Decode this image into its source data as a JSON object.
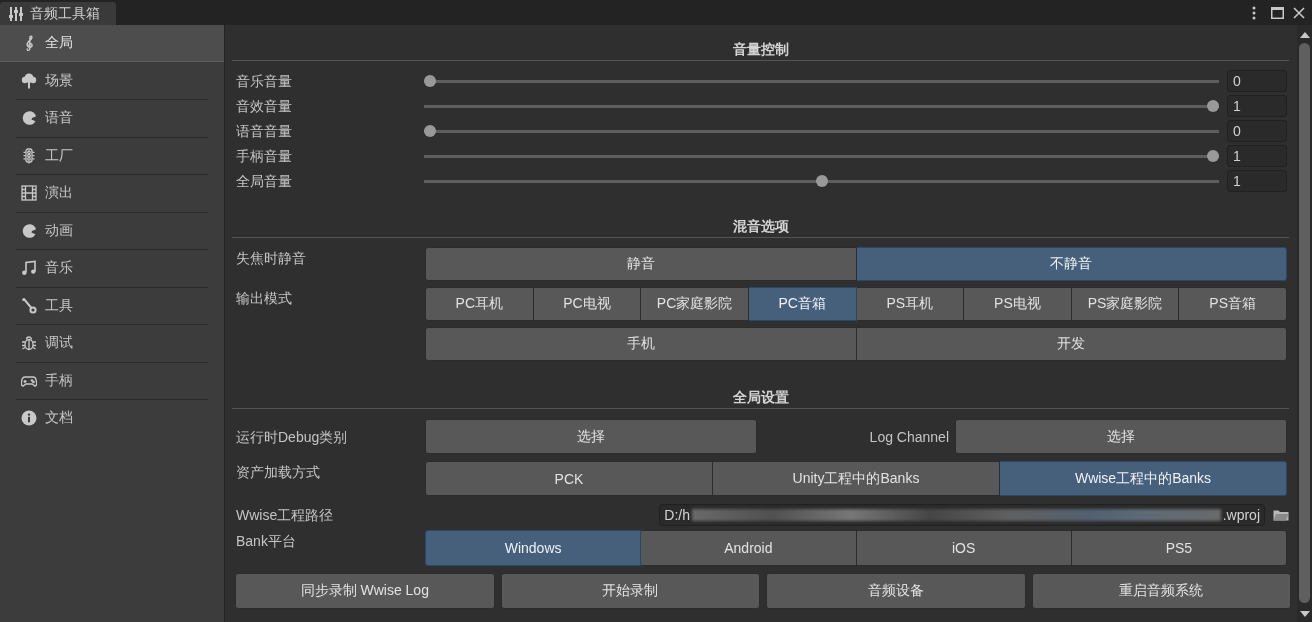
{
  "window": {
    "tab_title": "音频工具箱"
  },
  "sidebar": {
    "items": [
      {
        "label": "全局",
        "selected": true
      },
      {
        "label": "场景",
        "selected": false
      },
      {
        "label": "语音",
        "selected": false
      },
      {
        "label": "工厂",
        "selected": false
      },
      {
        "label": "演出",
        "selected": false
      },
      {
        "label": "动画",
        "selected": false
      },
      {
        "label": "音乐",
        "selected": false
      },
      {
        "label": "工具",
        "selected": false
      },
      {
        "label": "调试",
        "selected": false
      },
      {
        "label": "手柄",
        "selected": false
      },
      {
        "label": "文档",
        "selected": false
      }
    ]
  },
  "volume": {
    "title": "音量控制",
    "sliders": [
      {
        "label": "音乐音量",
        "level": 0,
        "value": "0"
      },
      {
        "label": "音效音量",
        "level": 1,
        "value": "1"
      },
      {
        "label": "语音音量",
        "level": 0,
        "value": "0"
      },
      {
        "label": "手柄音量",
        "level": 1,
        "value": "1"
      },
      {
        "label": "全局音量",
        "level": 0.5,
        "value": "1"
      }
    ]
  },
  "mixing": {
    "title": "混音选项",
    "focus_mute": {
      "label": "失焦时静音",
      "options": [
        {
          "label": "静音",
          "selected": false
        },
        {
          "label": "不静音",
          "selected": true
        }
      ]
    },
    "output_mode": {
      "label": "输出模式",
      "rows": [
        {
          "options": [
            {
              "label": "PC耳机",
              "selected": false
            },
            {
              "label": "PC电视",
              "selected": false
            },
            {
              "label": "PC家庭影院",
              "selected": false
            },
            {
              "label": "PC音箱",
              "selected": true
            },
            {
              "label": "PS耳机",
              "selected": false
            },
            {
              "label": "PS电视",
              "selected": false
            },
            {
              "label": "PS家庭影院",
              "selected": false
            },
            {
              "label": "PS音箱",
              "selected": false
            }
          ]
        },
        {
          "options": [
            {
              "label": "手机",
              "selected": false
            },
            {
              "label": "开发",
              "selected": false
            }
          ]
        }
      ]
    }
  },
  "global": {
    "title": "全局设置",
    "debug_category": {
      "label": "运行时Debug类别",
      "button": "选择"
    },
    "log_channel": {
      "label": "Log Channel",
      "button": "选择"
    },
    "asset_loading": {
      "label": "资产加载方式",
      "options": [
        {
          "label": "PCK",
          "selected": false
        },
        {
          "label": "Unity工程中的Banks",
          "selected": false
        },
        {
          "label": "Wwise工程中的Banks",
          "selected": true
        }
      ]
    },
    "wwise_path": {
      "label": "Wwise工程路径",
      "value_start": "D:/h",
      "value_end": ".wproj",
      "redacted": true
    },
    "bank_platform": {
      "label": "Bank平台",
      "options": [
        {
          "label": "Windows",
          "selected": true
        },
        {
          "label": "Android",
          "selected": false
        },
        {
          "label": "iOS",
          "selected": false
        },
        {
          "label": "PS5",
          "selected": false
        }
      ]
    }
  },
  "actions": [
    "同步录制 Wwise Log",
    "开始录制",
    "音频设备",
    "重启音频系统"
  ]
}
